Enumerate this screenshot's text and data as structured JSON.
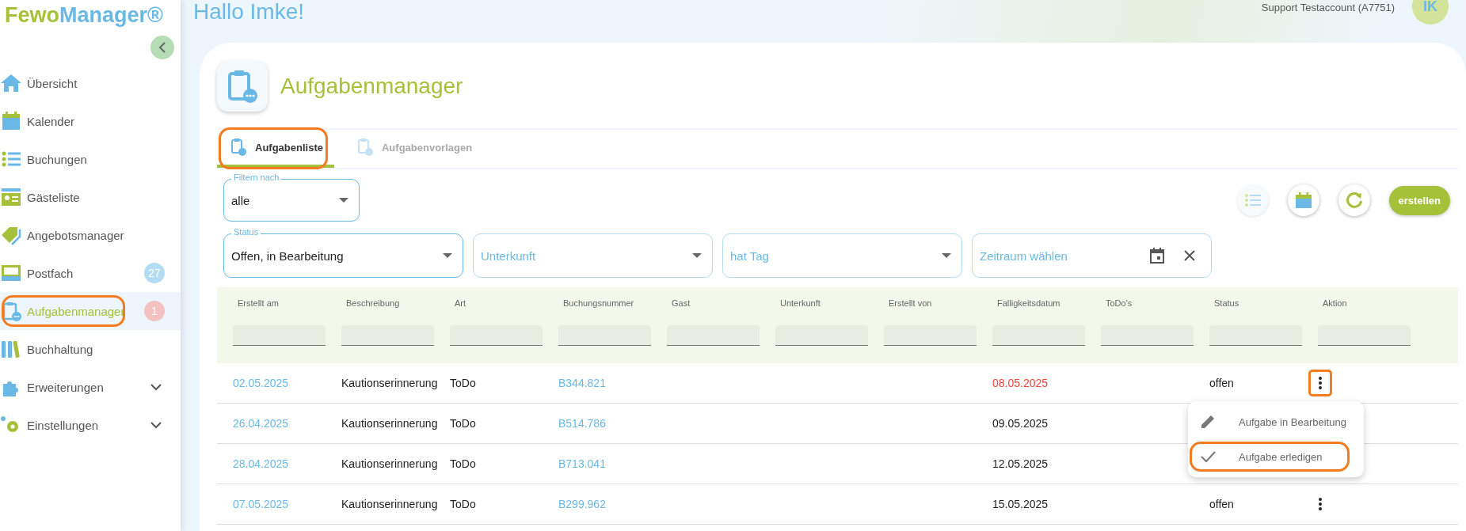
{
  "brand": {
    "part_1": "Fewo",
    "part_2": "Manager®"
  },
  "header": {
    "greeting": "Hallo Imke!",
    "account": "Support Testaccount (A7751)",
    "avatar": "IK"
  },
  "sidebar": {
    "items": [
      {
        "label": "Übersicht",
        "selected": false
      },
      {
        "label": "Kalender",
        "selected": false
      },
      {
        "label": "Buchungen",
        "selected": false
      },
      {
        "label": "Gästeliste",
        "selected": false
      },
      {
        "label": "Angebotsmanager",
        "selected": false
      },
      {
        "label": "Postfach",
        "selected": false,
        "badge": "27",
        "color": "#b3dcf3"
      },
      {
        "label": "Aufgabenmanager",
        "selected": true,
        "badge": "1",
        "color": "#f4c0c0",
        "highlighted": true
      },
      {
        "label": "Buchhaltung",
        "selected": false
      },
      {
        "label": "Erweiterungen",
        "selected": false,
        "expandable": true
      },
      {
        "label": "Einstellungen",
        "selected": false,
        "expandable": true
      }
    ]
  },
  "page": {
    "title": "Aufgabenmanager"
  },
  "tabs": [
    {
      "label": "Aufgabenliste",
      "selected": true,
      "highlighted": true
    },
    {
      "label": "Aufgabenvorlagen",
      "selected": false
    }
  ],
  "filter_by": {
    "label": "Filtern nach",
    "value": "alle"
  },
  "create_button": "erstellen",
  "filters": [
    {
      "kind": "select",
      "label": "Status",
      "value": "Offen, in Bearbeitung"
    },
    {
      "kind": "select",
      "placeholder": "Unterkunft"
    },
    {
      "kind": "select",
      "placeholder": "hat Tag"
    },
    {
      "kind": "date",
      "placeholder": "Zeitraum wählen"
    }
  ],
  "table": {
    "columns": [
      "Erstellt am",
      "Beschreibung",
      "Art",
      "Buchungsnummer",
      "Gast",
      "Unterkunft",
      "Erstellt von",
      "Falligkeitsdatum",
      "ToDo's",
      "Status",
      "Aktion"
    ],
    "rows": [
      {
        "created": "02.05.2025",
        "description": "Kautionserinnerung",
        "type": "ToDo",
        "booking": "B344.821",
        "due": "08.05.2025",
        "overdue": true,
        "status": "offen",
        "menu_button": true,
        "highlighted": true
      },
      {
        "created": "26.04.2025",
        "description": "Kautionserinnerung",
        "type": "ToDo",
        "booking": "B514.786",
        "due": "09.05.2025",
        "overdue": false,
        "menu_button": false,
        "highlighted": false
      },
      {
        "created": "28.04.2025",
        "description": "Kautionserinnerung",
        "type": "ToDo",
        "booking": "B713.041",
        "due": "12.05.2025",
        "overdue": false,
        "menu_button": false,
        "highlighted": false
      },
      {
        "created": "07.05.2025",
        "description": "Kautionserinnerung",
        "type": "ToDo",
        "booking": "B299.962",
        "due": "15.05.2025",
        "overdue": false,
        "status": "offen",
        "menu_button": true,
        "highlighted": false
      }
    ]
  },
  "action_menu": {
    "items": [
      {
        "label": "Aufgabe in Bearbeitung",
        "highlighted": false
      },
      {
        "label": "Aufgabe erledigen",
        "highlighted": true
      }
    ]
  }
}
